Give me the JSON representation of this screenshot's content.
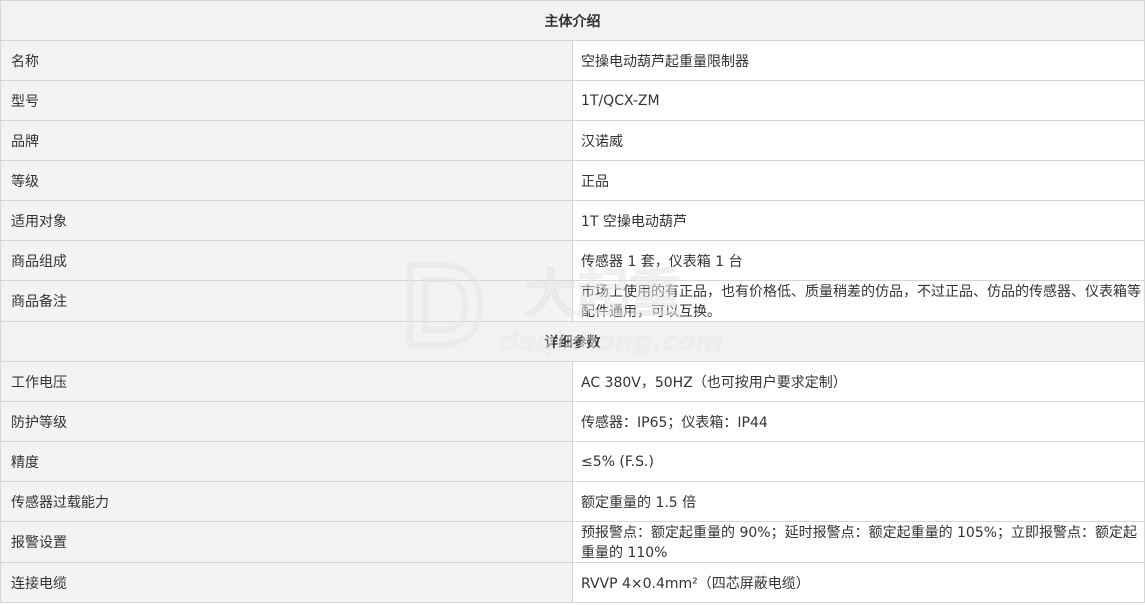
{
  "sections": [
    {
      "title": "主体介绍",
      "rows": [
        {
          "label": "名称",
          "value": "空操电动葫芦起重量限制器"
        },
        {
          "label": "型号",
          "value": "1T/QCX-ZM"
        },
        {
          "label": "品牌",
          "value": "汉诺威"
        },
        {
          "label": "等级",
          "value": "正品"
        },
        {
          "label": "适用对象",
          "value": "1T 空操电动葫芦"
        },
        {
          "label": "商品组成",
          "value": "传感器 1 套，仪表箱 1 台"
        },
        {
          "label": "商品备注",
          "value": "市场上使用的有正品，也有价格低、质量稍差的仿品，不过正品、仿品的传感器、仪表箱等配件通用，可以互换。"
        }
      ]
    },
    {
      "title": "详细参数",
      "rows": [
        {
          "label": "工作电压",
          "value": "AC 380V，50HZ（也可按用户要求定制）"
        },
        {
          "label": "防护等级",
          "value": "传感器：IP65；仪表箱：IP44"
        },
        {
          "label": "精度",
          "value": "≤5% (F.S.)"
        },
        {
          "label": "传感器过载能力",
          "value": "额定重量的 1.5 倍"
        },
        {
          "label": "报警设置",
          "value": "预报警点：额定起重量的 90%；延时报警点：额定起重量的 105%；立即报警点：额定起重量的 110%"
        },
        {
          "label": "连接电缆",
          "value": "RVVP 4×0.4mm²（四芯屏蔽电缆）"
        }
      ]
    }
  ],
  "watermark": {
    "text": "大起重",
    "url_text": "daqizhong.com"
  }
}
